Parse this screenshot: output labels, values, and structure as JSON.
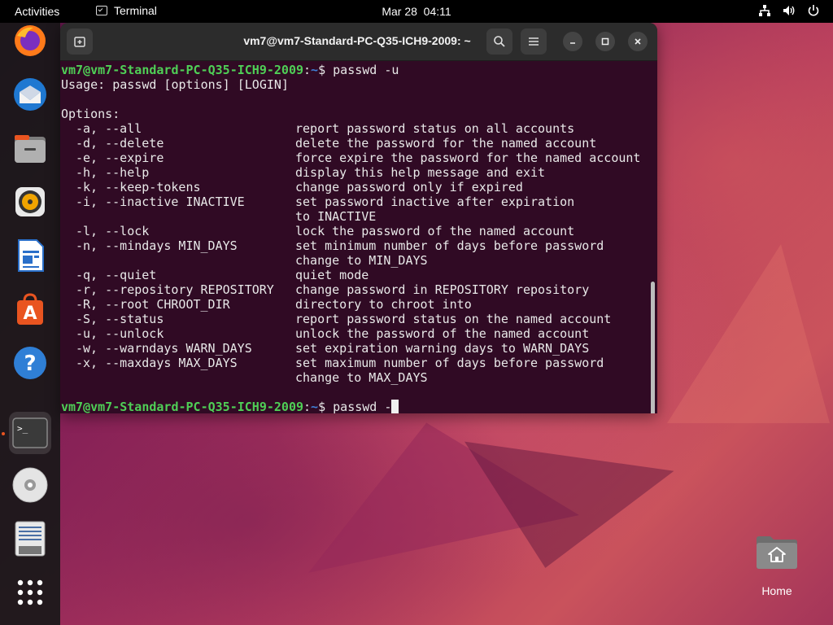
{
  "topbar": {
    "activities": "Activities",
    "app_name": "Terminal",
    "clock": "Mar 28  04:11"
  },
  "dock": {
    "items": [
      {
        "name": "firefox-icon"
      },
      {
        "name": "thunderbird-icon"
      },
      {
        "name": "files-icon"
      },
      {
        "name": "rhythmbox-icon"
      },
      {
        "name": "libreoffice-writer-icon"
      },
      {
        "name": "app-center-icon",
        "glyph": "A"
      },
      {
        "name": "help-icon",
        "glyph": "?"
      },
      {
        "name": "terminal-icon",
        "glyph": ">_"
      },
      {
        "name": "cd-drive-icon"
      },
      {
        "name": "text-editor-icon"
      },
      {
        "name": "show-apps-icon"
      }
    ]
  },
  "terminal": {
    "title": "vm7@vm7-Standard-PC-Q35-ICH9-2009: ~",
    "prompt_user": "vm7@vm7-Standard-PC-Q35-ICH9-2009",
    "prompt_sep": ":",
    "prompt_path": "~",
    "prompt_symbol": "$ ",
    "command1": "passwd -u",
    "usage": "Usage: passwd [options] [LOGIN]",
    "options_header": "Options:",
    "options": [
      {
        "opt": "-a, --all",
        "desc": "report password status on all accounts"
      },
      {
        "opt": "-d, --delete",
        "desc": "delete the password for the named account"
      },
      {
        "opt": "-e, --expire",
        "desc": "force expire the password for the named account"
      },
      {
        "opt": "-h, --help",
        "desc": "display this help message and exit"
      },
      {
        "opt": "-k, --keep-tokens",
        "desc": "change password only if expired"
      },
      {
        "opt": "-i, --inactive INACTIVE",
        "desc": "set password inactive after expiration"
      },
      {
        "opt": "",
        "desc": "to INACTIVE"
      },
      {
        "opt": "-l, --lock",
        "desc": "lock the password of the named account"
      },
      {
        "opt": "-n, --mindays MIN_DAYS",
        "desc": "set minimum number of days before password"
      },
      {
        "opt": "",
        "desc": "change to MIN_DAYS"
      },
      {
        "opt": "-q, --quiet",
        "desc": "quiet mode"
      },
      {
        "opt": "-r, --repository REPOSITORY",
        "desc": "change password in REPOSITORY repository"
      },
      {
        "opt": "-R, --root CHROOT_DIR",
        "desc": "directory to chroot into"
      },
      {
        "opt": "-S, --status",
        "desc": "report password status on the named account"
      },
      {
        "opt": "-u, --unlock",
        "desc": "unlock the password of the named account"
      },
      {
        "opt": "-w, --warndays WARN_DAYS",
        "desc": "set expiration warning days to WARN_DAYS"
      },
      {
        "opt": "-x, --maxdays MAX_DAYS",
        "desc": "set maximum number of days before password"
      },
      {
        "opt": "",
        "desc": "change to MAX_DAYS"
      }
    ],
    "command2": "passwd -"
  },
  "desktop": {
    "home_label": "Home"
  },
  "colors": {
    "terminal_bg": "#300a24",
    "prompt_user": "#4fcf56",
    "prompt_path": "#3f7fd6",
    "accent": "#e95420"
  }
}
